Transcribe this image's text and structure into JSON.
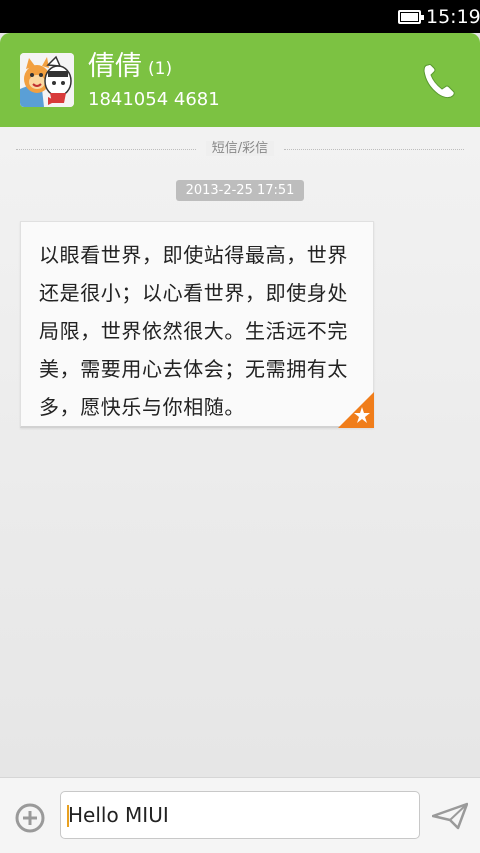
{
  "status_bar": {
    "time": "15:19",
    "battery_icon": "battery-full-icon"
  },
  "header": {
    "contact_name": "倩倩",
    "unread_count": "(1)",
    "phone_number": "1841054 4681",
    "call_icon": "phone-icon",
    "accent_color": "#7cc242"
  },
  "conversation": {
    "divider_label": "短信/彩信",
    "timestamp": "2013-2-25 17:51",
    "messages": [
      {
        "text": "以眼看世界，即使站得最高，世界还是很小；以心看世界，即使身处局限，世界依然很大。生活远不完美，需要用心去体会；无需拥有太多，愿快乐与你相随。",
        "starred": true,
        "star_color": "#f07d1a"
      }
    ]
  },
  "composer": {
    "input_value": "Hello MIUI",
    "add_icon": "add-circle-icon",
    "send_icon": "send-icon"
  }
}
